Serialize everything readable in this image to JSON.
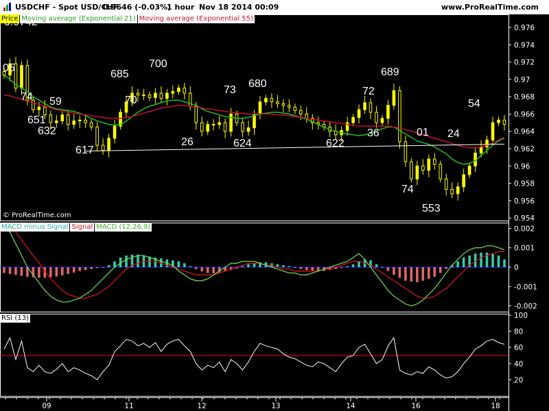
{
  "header": {
    "symbol": "USDCHF - Spot USD/CHF",
    "price": "0.9646 (-0.03%)",
    "timeframe": "1 hour",
    "datetime": "Nov 18 2014 00:09",
    "site": "www.ProRealTime.com"
  },
  "legend": {
    "price_label": "Price",
    "ema21_label": "Moving average (Exponential 21)",
    "ema55_label": "Moving average (Exponential 55)",
    "macd_hist_label": "MACD minus Signal",
    "signal_label": "Signal",
    "macd_label": "MACD (12,26,9)",
    "rsi_label": "RSI (13)"
  },
  "watermark": "© ProRealTime.com",
  "colors": {
    "background": "#000000",
    "candle": "#ffff00",
    "ema21": "#22c022",
    "ema55": "#c8102e",
    "hist_pos": "#33ccaa",
    "hist_neg": "#e06666",
    "macd_line": "#6dd24a",
    "signal_line": "#d0141e",
    "rsi_line": "#ffffff",
    "rsi_level": "#ff0000",
    "trendline": "#ffffff",
    "axis_text": "#ffffff"
  },
  "chart_data": [
    {
      "type": "candlestick",
      "title": "USDCHF - Spot USD/CHF",
      "ylim": [
        0.9537,
        0.9775
      ],
      "yticks": [
        "0.976",
        "0.974",
        "0.972",
        "0.97",
        "0.968",
        "0.966",
        "0.964",
        "0.962",
        "0.96",
        "0.958",
        "0.956",
        "0.954"
      ],
      "xticks": [
        "09",
        "11",
        "12",
        "13",
        "14",
        "16",
        "18"
      ],
      "series": [
        {
          "name": "Moving average (Exponential 21)",
          "values": [
            0.9705,
            0.97,
            0.9694,
            0.969,
            0.9686,
            0.968,
            0.9676,
            0.9672,
            0.9668,
            0.9666,
            0.9665,
            0.9664,
            0.9663,
            0.9661,
            0.9658,
            0.9655,
            0.9652,
            0.965,
            0.9648,
            0.9647,
            0.9648,
            0.9652,
            0.9657,
            0.9662,
            0.9666,
            0.9669,
            0.9671,
            0.9673,
            0.9675,
            0.9676,
            0.9676,
            0.9674,
            0.9672,
            0.967,
            0.9666,
            0.9663,
            0.9661,
            0.9659,
            0.9657,
            0.9656,
            0.9655,
            0.9655,
            0.9656,
            0.9658,
            0.966,
            0.9661,
            0.9662,
            0.9662,
            0.9661,
            0.966,
            0.9658,
            0.9656,
            0.9654,
            0.9651,
            0.9648,
            0.9645,
            0.9642,
            0.964,
            0.9638,
            0.9637,
            0.9636,
            0.9635,
            0.9636,
            0.9638,
            0.964,
            0.9643,
            0.9645,
            0.9645,
            0.9641,
            0.9637,
            0.9633,
            0.9629,
            0.9627,
            0.9625,
            0.9622,
            0.9618,
            0.9614,
            0.9608,
            0.9604,
            0.9602,
            0.9603,
            0.9606,
            0.9612,
            0.9618,
            0.9624,
            0.9629,
            0.9632
          ]
        },
        {
          "name": "Moving average (Exponential 55)",
          "values": [
            0.9682,
            0.9681,
            0.9679,
            0.9677,
            0.9675,
            0.9673,
            0.9671,
            0.9669,
            0.9667,
            0.9665,
            0.9664,
            0.9662,
            0.9661,
            0.966,
            0.9659,
            0.9658,
            0.9657,
            0.9656,
            0.9655,
            0.9655,
            0.9655,
            0.9656,
            0.9657,
            0.9659,
            0.9661,
            0.9663,
            0.9665,
            0.9667,
            0.9668,
            0.9669,
            0.967,
            0.967,
            0.9669,
            0.9668,
            0.9667,
            0.9666,
            0.9665,
            0.9664,
            0.9663,
            0.9662,
            0.9661,
            0.9661,
            0.966,
            0.966,
            0.966,
            0.966,
            0.966,
            0.9659,
            0.9659,
            0.9658,
            0.9657,
            0.9656,
            0.9655,
            0.9654,
            0.9653,
            0.9652,
            0.9651,
            0.965,
            0.9649,
            0.9648,
            0.9647,
            0.9646,
            0.9646,
            0.9646,
            0.9646,
            0.9646,
            0.9646,
            0.9645,
            0.9644,
            0.9642,
            0.964,
            0.9638,
            0.9636,
            0.9634,
            0.9632,
            0.963,
            0.9628,
            0.9626,
            0.9624,
            0.9622,
            0.9621,
            0.9621,
            0.9622,
            0.9624,
            0.9627,
            0.963,
            0.9633
          ]
        }
      ],
      "candles_close": [
        0.9705,
        0.9718,
        0.969,
        0.9716,
        0.9676,
        0.9665,
        0.9668,
        0.9659,
        0.965,
        0.9652,
        0.9659,
        0.9648,
        0.9652,
        0.9653,
        0.965,
        0.9645,
        0.9624,
        0.9618,
        0.9632,
        0.9646,
        0.9662,
        0.9674,
        0.9684,
        0.9682,
        0.9682,
        0.9679,
        0.9684,
        0.9678,
        0.9684,
        0.9686,
        0.969,
        0.9684,
        0.9669,
        0.965,
        0.964,
        0.9648,
        0.9648,
        0.965,
        0.964,
        0.966,
        0.965,
        0.964,
        0.9644,
        0.966,
        0.9674,
        0.9678,
        0.9674,
        0.9672,
        0.967,
        0.9668,
        0.9664,
        0.966,
        0.9655,
        0.965,
        0.9648,
        0.9645,
        0.964,
        0.9636,
        0.9641,
        0.965,
        0.9656,
        0.9665,
        0.9673,
        0.9662,
        0.965,
        0.9655,
        0.967,
        0.9687,
        0.9628,
        0.9605,
        0.9585,
        0.96,
        0.9595,
        0.9608,
        0.9602,
        0.9585,
        0.9573,
        0.9568,
        0.9576,
        0.959,
        0.96,
        0.9615,
        0.9622,
        0.963,
        0.965,
        0.9653,
        0.9648
      ],
      "annotations": [
        "0.9742",
        "05",
        "74",
        "59",
        "651",
        "632",
        "617",
        "685",
        "70",
        "700",
        "26",
        "73",
        "624",
        "680",
        "622",
        "72",
        "36",
        "689",
        "74",
        "01",
        "553",
        "24",
        "54"
      ]
    },
    {
      "type": "bar",
      "title": "MACD (12,26,9)",
      "ylim": [
        -0.0023,
        0.0023
      ],
      "yticks": [
        "0.002",
        "0.001",
        "0",
        "-0.001",
        "-0.002"
      ],
      "series": [
        {
          "name": "MACD minus Signal",
          "values": [
            -0.0003,
            -0.00035,
            -0.0004,
            -0.00045,
            -0.0005,
            -0.00052,
            -0.00055,
            -0.00055,
            -0.00052,
            -0.00048,
            -0.00042,
            -0.00035,
            -0.00028,
            -0.0002,
            -0.00015,
            -0.0001,
            -5e-05,
            -2e-05,
            0.0001,
            0.0003,
            0.0005,
            0.0006,
            0.00065,
            0.00065,
            0.0006,
            0.00055,
            0.0005,
            0.00045,
            0.0004,
            0.00035,
            0.0003,
            0.0002,
            5e-05,
            -0.0001,
            -0.00022,
            -0.0003,
            -0.00032,
            -0.00028,
            -0.00022,
            -0.00015,
            -8e-05,
            5e-05,
            0.00015,
            0.0002,
            0.00025,
            0.00025,
            0.0002,
            0.00015,
            0.0001,
            5e-05,
            0.0,
            -0.0001,
            -0.00015,
            -0.0002,
            -0.00022,
            -0.0002,
            -0.00015,
            -0.0001,
            -5e-05,
            5e-05,
            0.00015,
            0.0003,
            0.0004,
            0.00035,
            0.00015,
            0.0,
            -0.0002,
            -0.0004,
            -0.00055,
            -0.0007,
            -0.00075,
            -0.00078,
            -0.0007,
            -0.0006,
            -0.0005,
            -0.0003,
            -0.0001,
            0.0001,
            0.0003,
            0.0005,
            0.0006,
            0.0007,
            0.00075,
            0.00075,
            0.0007,
            0.0006,
            0.0004
          ]
        },
        {
          "name": "Signal",
          "values": [
            0.0023,
            0.0021,
            0.0018,
            0.0014,
            0.001,
            0.0006,
            0.0002,
            -0.0002,
            -0.0006,
            -0.0009,
            -0.0012,
            -0.0014,
            -0.0015,
            -0.0016,
            -0.0016,
            -0.0015,
            -0.0014,
            -0.0012,
            -0.001,
            -0.0007,
            -0.0004,
            -0.0001,
            0.0001,
            0.0002,
            0.0003,
            0.0003,
            0.0003,
            0.0002,
            0.0001,
            0.0,
            -0.0001,
            -0.0002,
            -0.0003,
            -0.0004,
            -0.0004,
            -0.0004,
            -0.0004,
            -0.0003,
            -0.0002,
            -0.0001,
            0.0,
            0.0001,
            0.0002,
            0.0002,
            0.0002,
            0.0001,
            0.0001,
            0.0,
            -0.0001,
            -0.0001,
            -0.0002,
            -0.0002,
            -0.0002,
            -0.0002,
            -0.0002,
            -0.0001,
            -0.0001,
            0.0,
            0.0001,
            0.0002,
            0.0003,
            0.0003,
            0.0002,
            0.0001,
            -0.0001,
            -0.0003,
            -0.0005,
            -0.0007,
            -0.0009,
            -0.0011,
            -0.0013,
            -0.0015,
            -0.0016,
            -0.0016,
            -0.0015,
            -0.0013,
            -0.0011,
            -0.0008,
            -0.0005,
            -0.0002,
            0.0001,
            0.0003,
            0.0005,
            0.0006,
            0.0007,
            0.0008,
            0.0008
          ]
        },
        {
          "name": "MACD (12,26,9)",
          "values": [
            0.0022,
            0.0018,
            0.0012,
            0.0006,
            0.0,
            -0.0004,
            -0.0008,
            -0.0012,
            -0.0015,
            -0.0017,
            -0.0018,
            -0.0018,
            -0.0017,
            -0.0016,
            -0.0014,
            -0.0012,
            -0.0009,
            -0.0006,
            -0.0003,
            0.0,
            0.0002,
            0.0004,
            0.0005,
            0.0006,
            0.0006,
            0.0005,
            0.0004,
            0.0003,
            0.0002,
            0.0001,
            -0.0002,
            -0.0004,
            -0.0006,
            -0.0007,
            -0.0007,
            -0.0006,
            -0.0004,
            -0.0002,
            0.0,
            0.0002,
            0.0002,
            0.0003,
            0.0003,
            0.0003,
            0.0002,
            0.0001,
            0.0,
            -0.0001,
            -0.0002,
            -0.0003,
            -0.0003,
            -0.0004,
            -0.0004,
            -0.0003,
            -0.0002,
            -0.0001,
            0.0,
            0.0001,
            0.0002,
            0.0003,
            0.0005,
            0.0007,
            0.0004,
            0.0,
            -0.0004,
            -0.0008,
            -0.0012,
            -0.0015,
            -0.0017,
            -0.0019,
            -0.002,
            -0.0019,
            -0.0017,
            -0.0014,
            -0.0011,
            -0.0007,
            -0.0003,
            0.0001,
            0.0004,
            0.0007,
            0.0009,
            0.001,
            0.001,
            0.0011,
            0.0011,
            0.001,
            0.0009
          ]
        }
      ]
    },
    {
      "type": "line",
      "title": "RSI (13)",
      "ylim": [
        0,
        100
      ],
      "yticks": [
        "100",
        "80",
        "60",
        "40",
        "20"
      ],
      "level": 50,
      "series": [
        {
          "name": "RSI (13)",
          "values": [
            58,
            72,
            45,
            68,
            35,
            30,
            38,
            30,
            28,
            33,
            40,
            30,
            35,
            32,
            28,
            25,
            20,
            30,
            38,
            55,
            62,
            70,
            68,
            62,
            65,
            60,
            66,
            55,
            64,
            68,
            70,
            62,
            55,
            40,
            32,
            38,
            35,
            42,
            30,
            45,
            40,
            32,
            42,
            55,
            65,
            62,
            60,
            58,
            52,
            48,
            46,
            42,
            38,
            36,
            42,
            40,
            35,
            30,
            40,
            48,
            50,
            60,
            64,
            52,
            40,
            45,
            62,
            72,
            32,
            28,
            26,
            30,
            28,
            36,
            32,
            26,
            22,
            24,
            30,
            40,
            48,
            58,
            62,
            68,
            70,
            66,
            64
          ]
        }
      ]
    }
  ]
}
